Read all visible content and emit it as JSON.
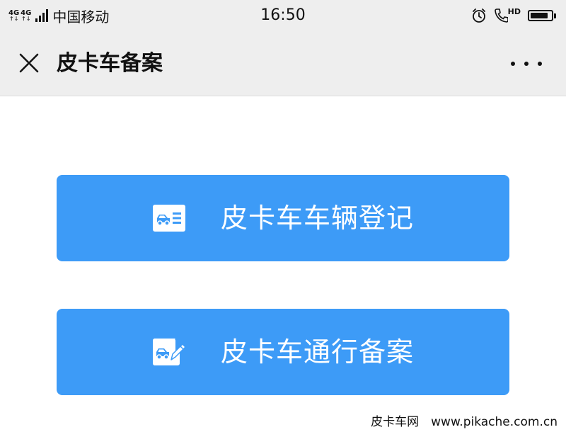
{
  "status_bar": {
    "network_1": "4G",
    "network_2": "4G",
    "network_arrows": "↑↓",
    "carrier": "中国移动",
    "time": "16:50",
    "call_badge": "HD",
    "battery_level": 0.85
  },
  "nav": {
    "title": "皮卡车备案"
  },
  "actions": [
    {
      "label": "皮卡车车辆登记",
      "icon": "vehicle-card-icon"
    },
    {
      "label": "皮卡车通行备案",
      "icon": "vehicle-edit-icon"
    }
  ],
  "watermark": "皮卡车网　www.pikache.com.cn",
  "colors": {
    "accent": "#3d9bf7",
    "bar_bg": "#eeeeee"
  }
}
